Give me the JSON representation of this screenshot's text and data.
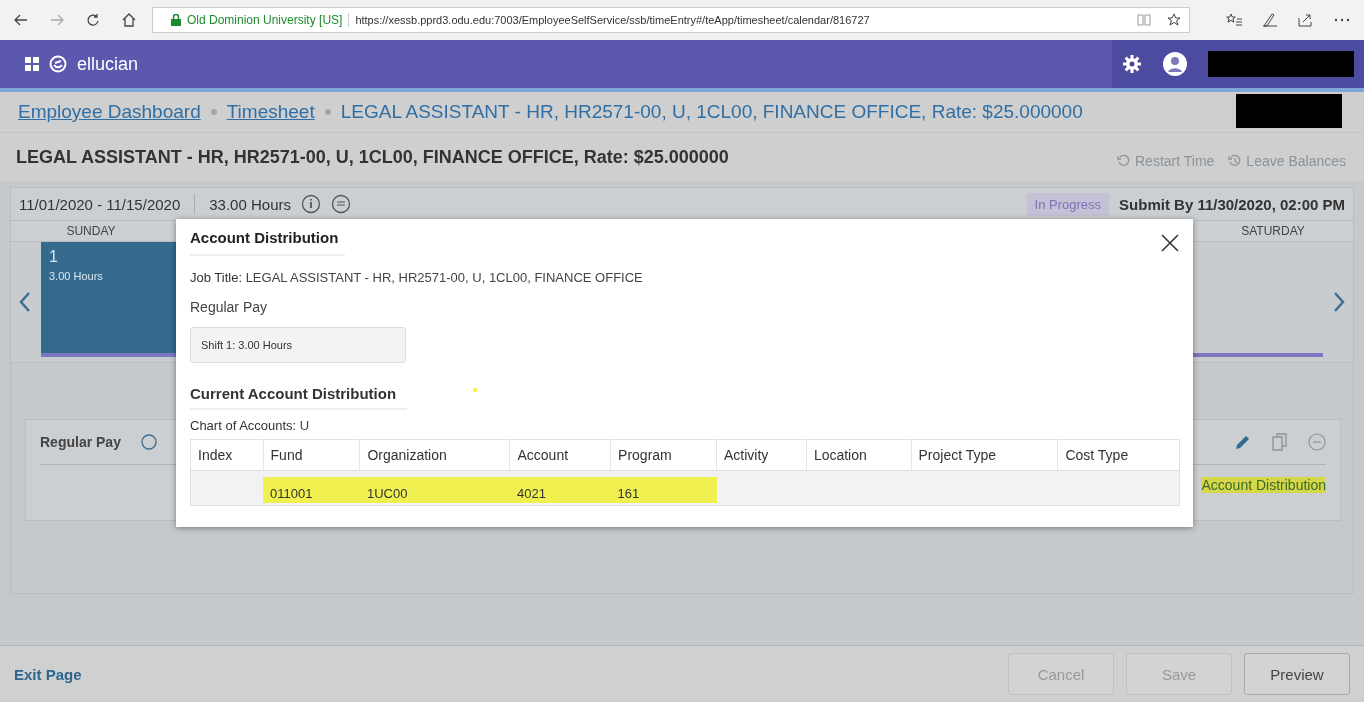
{
  "browser": {
    "site_name": "Old Dominion University [US]",
    "url": "https://xessb.pprd3.odu.edu:7003/EmployeeSelfService/ssb/timeEntry#/teApp/timesheet/calendar/816727"
  },
  "header": {
    "brand": "ellucian"
  },
  "breadcrumbs": [
    {
      "label": "Employee Dashboard",
      "kind": "link"
    },
    {
      "label": "Timesheet",
      "kind": "link"
    },
    {
      "label": "LEGAL ASSISTANT - HR, HR2571-00, U, 1CL00, FINANCE OFFICE, Rate: $25.000000",
      "kind": "current"
    }
  ],
  "page_title": "LEGAL ASSISTANT - HR, HR2571-00, U, 1CL00, FINANCE OFFICE, Rate: $25.000000",
  "actions": [
    {
      "label": "Restart Time",
      "kind": "restart"
    },
    {
      "label": "Leave Balances",
      "kind": "balances"
    }
  ],
  "timesheet": {
    "period": "11/01/2020 - 11/15/2020",
    "hours": "33.00 Hours",
    "status": "In Progress",
    "submit_by": "Submit By 11/30/2020, 02:00 PM",
    "days": [
      {
        "label": "SUNDAY",
        "date": "1",
        "hours": "3.00 Hours"
      },
      {
        "label": "SATURDAY"
      }
    ]
  },
  "entry": {
    "label": "Regular Pay",
    "link": "Account Distribution",
    "highlighted": true
  },
  "modal": {
    "title": "Account Distribution",
    "job_title_label": "Job Title:",
    "job_title": "LEGAL ASSISTANT - HR, HR2571-00, U, 1CL00, FINANCE OFFICE",
    "earning": "Regular Pay",
    "shift": "Shift 1: 3.00 Hours",
    "section_title": "Current Account Distribution",
    "coa_label": "Chart of Accounts:",
    "coa": "U",
    "table": {
      "columns": [
        "Index",
        "Fund",
        "Organization",
        "Account",
        "Program",
        "Activity",
        "Location",
        "Project Type",
        "Cost Type"
      ],
      "rows": [
        {
          "highlighted": true,
          "cells": [
            null,
            "011001",
            "1UC00",
            "4021",
            "161",
            null,
            null,
            null,
            null
          ]
        }
      ]
    }
  },
  "footer": {
    "exit": "Exit Page",
    "buttons": [
      {
        "label": "Cancel",
        "disabled": true
      },
      {
        "label": "Save",
        "disabled": true
      },
      {
        "label": "Preview",
        "disabled": false
      }
    ]
  }
}
